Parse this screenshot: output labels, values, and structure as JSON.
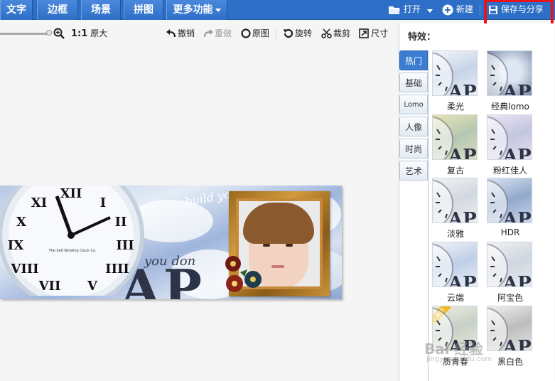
{
  "topbar": {
    "tabs": [
      {
        "label": "文字"
      },
      {
        "label": "边框"
      },
      {
        "label": "场景"
      },
      {
        "label": "拼图"
      },
      {
        "label": "更多功能"
      }
    ],
    "open_label": "打开",
    "new_label": "新建",
    "save_share_label": "保存与分享"
  },
  "toolbar": {
    "zoom_ratio": "1:1",
    "original_size_label": "原大",
    "undo_label": "撤销",
    "redo_label": "重做",
    "original_label": "原图",
    "rotate_label": "旋转",
    "crop_label": "裁剪",
    "resize_label": "尺寸"
  },
  "canvas": {
    "text_big": "AP",
    "text_script": "you don",
    "text_world": "build yo",
    "clock_brand": "The Self Winding Clock Co."
  },
  "panel": {
    "title": "特效：",
    "tabs": [
      {
        "label": "热门",
        "active": true
      },
      {
        "label": "基础"
      },
      {
        "label": "Lomo"
      },
      {
        "label": "人像"
      },
      {
        "label": "时尚"
      },
      {
        "label": "艺术"
      }
    ],
    "effects": [
      {
        "label": "柔光"
      },
      {
        "label": "经典lomo"
      },
      {
        "label": "复古"
      },
      {
        "label": "粉红佳人"
      },
      {
        "label": "淡雅"
      },
      {
        "label": "HDR"
      },
      {
        "label": "云端"
      },
      {
        "label": "阿宝色"
      },
      {
        "label": "质青春",
        "badge": "会员"
      },
      {
        "label": "黑白色"
      }
    ],
    "watermark": "Bai 经验",
    "watermark_url": "jingyan.baidu.com"
  },
  "colors": {
    "topbar": "#2d6fc6",
    "highlight": "#e8121b",
    "active_tab": "#3c7dd2"
  }
}
